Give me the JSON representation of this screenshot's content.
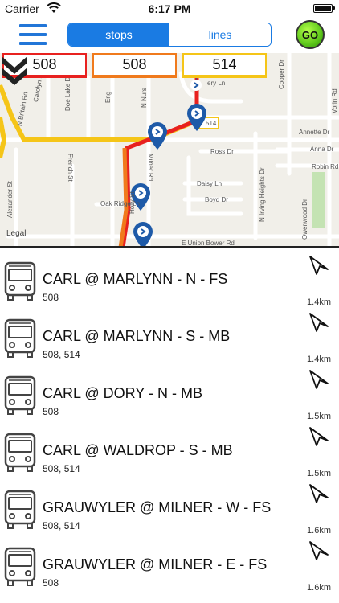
{
  "status_bar": {
    "carrier": "Carrier",
    "time": "6:17 PM"
  },
  "nav": {
    "segments": [
      {
        "label": "stops",
        "active": true
      },
      {
        "label": "lines",
        "active": false
      }
    ],
    "go_label": "GO"
  },
  "map": {
    "legal": "Legal",
    "route_tags": [
      {
        "label": "508",
        "color": "#e8211f"
      },
      {
        "label": "508",
        "color": "#f07a1c"
      },
      {
        "label": "514",
        "color": "#f5c518"
      }
    ],
    "street_labels": [
      "Carolyn St",
      "Doe Lake Dr",
      "Eng",
      "N Nurs",
      "Ross Dr",
      "French St",
      "Milner Rd",
      "Daisy Ln",
      "Boyd Dr",
      "Oak Ridge Ln",
      "Holly St",
      "E Union Bower Rd",
      "N Irving Heights Dr",
      "Owenwood Dr",
      "Cooper Dr",
      "Vorin Rd",
      "Annette Dr",
      "Anna Dr",
      "Robin Rd",
      "N Britain Rd",
      "Alexander St",
      "ery Ln",
      "514"
    ]
  },
  "stops": [
    {
      "name": "CARL @ MARLYNN - N - FS",
      "lines": "508",
      "distance": "1.4km"
    },
    {
      "name": "CARL @ MARLYNN - S - MB",
      "lines": "508, 514",
      "distance": "1.4km"
    },
    {
      "name": "CARL @ DORY - N - MB",
      "lines": "508",
      "distance": "1.5km"
    },
    {
      "name": "CARL @ WALDROP - S - MB",
      "lines": "508, 514",
      "distance": "1.5km"
    },
    {
      "name": "GRAUWYLER @ MILNER - W - FS",
      "lines": "508, 514",
      "distance": "1.6km"
    },
    {
      "name": "GRAUWYLER @ MILNER - E - FS",
      "lines": "508",
      "distance": "1.6km"
    }
  ]
}
